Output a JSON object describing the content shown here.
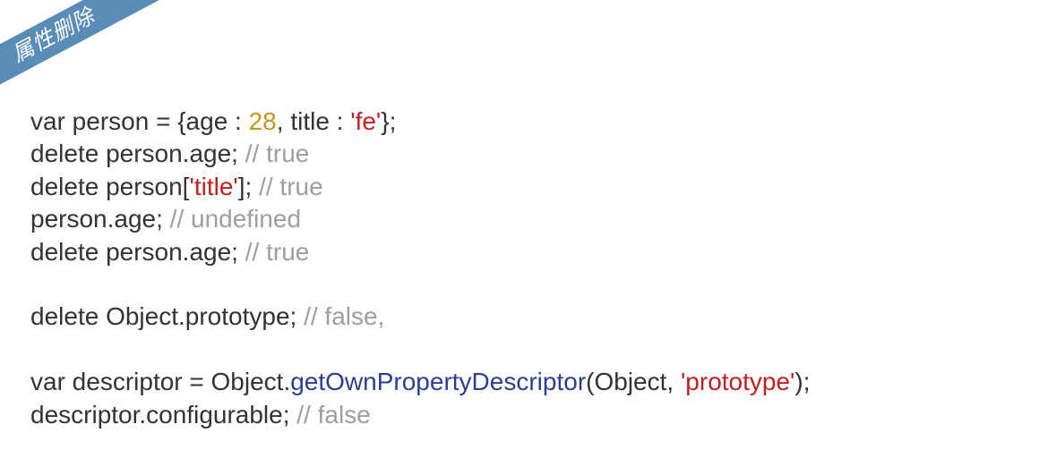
{
  "ribbon": {
    "label": "属性删除"
  },
  "code": {
    "l1": {
      "a": "var person = {age : ",
      "num": "28",
      "b": ", title : ",
      "str": "'fe'",
      "c": "};"
    },
    "l2": {
      "a": "delete person.age; ",
      "cmt": "// true"
    },
    "l3": {
      "a": "delete person[",
      "str": "'title'",
      "b": "]; ",
      "cmt": "// true"
    },
    "l4": {
      "a": "person.age; ",
      "cmt": "// undefined"
    },
    "l5": {
      "a": "delete person.age; ",
      "cmt": "// true"
    },
    "l6": {
      "a": "delete Object.prototype; ",
      "cmt": "// false,"
    },
    "l7": {
      "a": "var descriptor = Object.",
      "fn": "getOwnPropertyDescriptor",
      "b": "(Object, ",
      "prm": "'prototype'",
      "c": ");"
    },
    "l8": {
      "a": "descriptor.configurable; ",
      "cmt": "// false"
    }
  }
}
